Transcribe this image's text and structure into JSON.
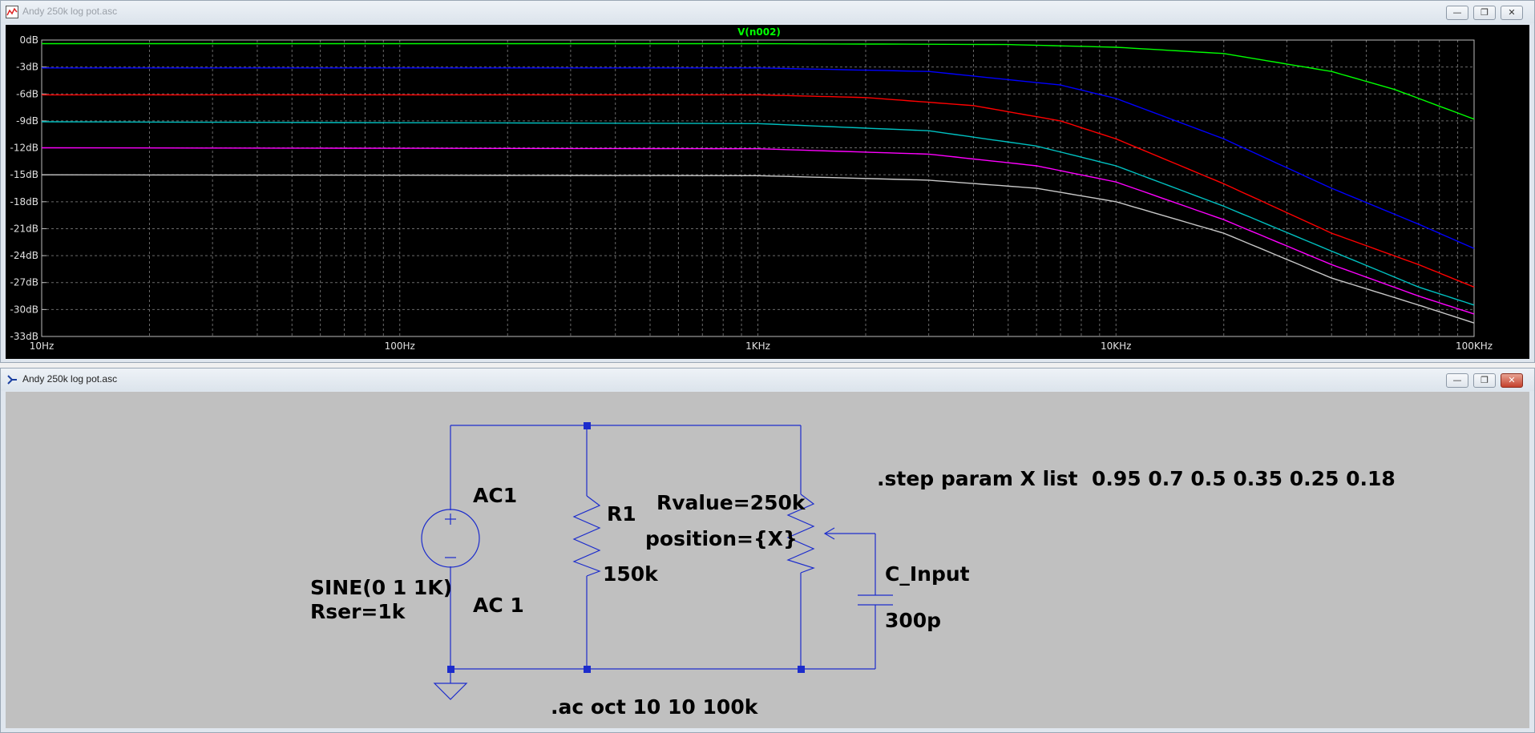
{
  "plot_window": {
    "title": "Andy 250k log pot.asc",
    "trace_label": "V(n002)",
    "buttons": {
      "minimize": "—",
      "restore": "❐",
      "close": "✕"
    }
  },
  "schematic_window": {
    "title": "Andy 250k log pot.asc",
    "buttons": {
      "minimize": "—",
      "restore": "❐",
      "close": "✕"
    },
    "labels": {
      "source_name": "AC1",
      "source_value": "SINE(0 1 1K)",
      "source_rser": "Rser=1k",
      "source_ac": "AC 1",
      "r1_name": "R1",
      "r1_value": "150k",
      "pot_rvalue": "Rvalue=250k",
      "pot_position": "position={X}",
      "cap_name": "C_Input",
      "cap_value": "300p",
      "step_directive": ".step param X list  0.95 0.7 0.5 0.35 0.25 0.18",
      "ac_directive": ".ac oct 10 10 100k"
    }
  },
  "chart_data": {
    "type": "line",
    "title": "V(n002)",
    "x_scale": "log",
    "xlim": [
      10,
      100000
    ],
    "ylim": [
      -33,
      0
    ],
    "x_ticks": [
      {
        "value": 10,
        "label": "10Hz"
      },
      {
        "value": 100,
        "label": "100Hz"
      },
      {
        "value": 1000,
        "label": "1KHz"
      },
      {
        "value": 10000,
        "label": "10KHz"
      },
      {
        "value": 100000,
        "label": "100KHz"
      }
    ],
    "y_ticks": [
      {
        "value": 0,
        "label": "0dB"
      },
      {
        "value": -3,
        "label": "-3dB"
      },
      {
        "value": -6,
        "label": "-6dB"
      },
      {
        "value": -9,
        "label": "-9dB"
      },
      {
        "value": -12,
        "label": "-12dB"
      },
      {
        "value": -15,
        "label": "-15dB"
      },
      {
        "value": -18,
        "label": "-18dB"
      },
      {
        "value": -21,
        "label": "-21dB"
      },
      {
        "value": -24,
        "label": "-24dB"
      },
      {
        "value": -27,
        "label": "-27dB"
      },
      {
        "value": -30,
        "label": "-30dB"
      },
      {
        "value": -33,
        "label": "-33dB"
      }
    ],
    "grid": true,
    "series": [
      {
        "color": "#00ff00",
        "x": [
          10,
          1000,
          5000,
          10000,
          20000,
          40000,
          60000,
          100000
        ],
        "y": [
          -0.4,
          -0.4,
          -0.5,
          -0.8,
          -1.5,
          -3.5,
          -5.5,
          -8.8
        ]
      },
      {
        "color": "#0000ff",
        "x": [
          10,
          1000,
          3000,
          7000,
          10000,
          20000,
          40000,
          70000,
          100000
        ],
        "y": [
          -3.1,
          -3.1,
          -3.5,
          -5.0,
          -6.5,
          -11.0,
          -16.5,
          -20.5,
          -23.2
        ]
      },
      {
        "color": "#ff0000",
        "x": [
          10,
          1000,
          2000,
          4000,
          7000,
          10000,
          20000,
          40000,
          70000,
          100000
        ],
        "y": [
          -6.1,
          -6.1,
          -6.4,
          -7.3,
          -9.0,
          -11.0,
          -16.0,
          -21.5,
          -25.0,
          -27.5
        ]
      },
      {
        "color": "#00c0c0",
        "x": [
          10,
          1000,
          3000,
          6000,
          10000,
          20000,
          40000,
          70000,
          100000
        ],
        "y": [
          -9.1,
          -9.3,
          -10.1,
          -11.8,
          -14.0,
          -18.5,
          -23.5,
          -27.5,
          -29.5
        ]
      },
      {
        "color": "#ff00ff",
        "x": [
          10,
          1000,
          3000,
          6000,
          10000,
          20000,
          40000,
          70000,
          100000
        ],
        "y": [
          -12.0,
          -12.1,
          -12.7,
          -14.0,
          -15.8,
          -20.0,
          -25.0,
          -28.5,
          -30.5
        ]
      },
      {
        "color": "#c8c8c8",
        "x": [
          10,
          1000,
          3000,
          6000,
          10000,
          20000,
          40000,
          70000,
          100000
        ],
        "y": [
          -15.0,
          -15.1,
          -15.6,
          -16.5,
          -18.0,
          -21.5,
          -26.5,
          -29.5,
          -31.5
        ]
      }
    ]
  }
}
